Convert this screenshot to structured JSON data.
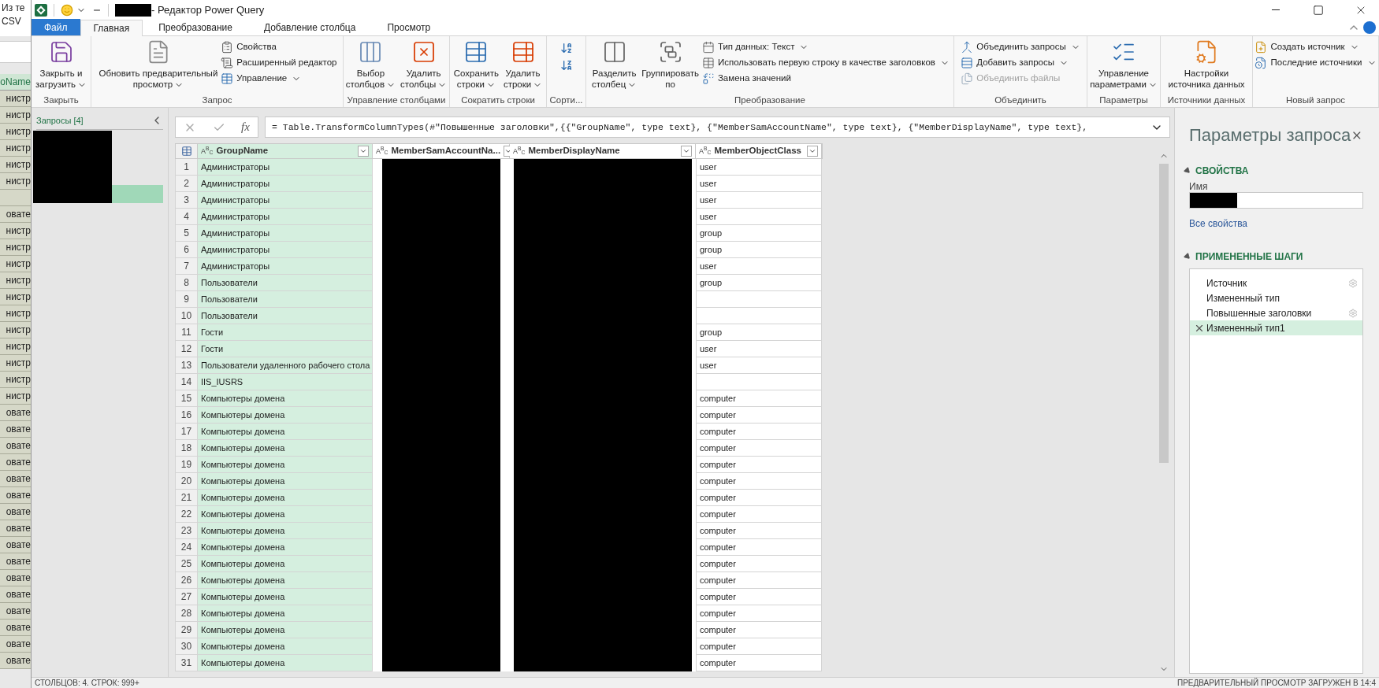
{
  "background_window": {
    "header_lines": [
      "Из те",
      "CSV"
    ],
    "column_header": "oName",
    "rows": [
      "нистр",
      "нистр",
      "нистр",
      "нистр",
      "нистр",
      "нистр",
      "",
      "овате",
      "нистр",
      "нистр",
      "нистр",
      "нистр",
      "нистр",
      "нистр",
      "нистр",
      "нистр",
      "нистр",
      "нистр",
      "нистр",
      "овате",
      "овате",
      "овате",
      "овате",
      "овате",
      "овате",
      "овате",
      "овате",
      "овате",
      "овате",
      "овате",
      "овате",
      "овате",
      "овате",
      "овате",
      "овате"
    ]
  },
  "window": {
    "title": "- Редактор Power Query"
  },
  "tabs": [
    {
      "label": "Файл",
      "kind": "file",
      "selected": false
    },
    {
      "label": "Главная",
      "kind": "tab",
      "selected": true
    },
    {
      "label": "Преобразование",
      "kind": "tab",
      "selected": false
    },
    {
      "label": "Добавление столбца",
      "kind": "tab",
      "selected": false
    },
    {
      "label": "Просмотр",
      "kind": "tab",
      "selected": false
    }
  ],
  "ribbon": [
    {
      "label": "Закрыть",
      "items": [
        {
          "kind": "large",
          "lines": [
            "Закрыть и",
            "загрузить"
          ],
          "dropdown": true,
          "disabled": false
        }
      ]
    },
    {
      "label": "Запрос",
      "items": [
        {
          "kind": "large",
          "lines": [
            "Обновить предварительный",
            "просмотр"
          ],
          "dropdown": true,
          "disabled": false
        },
        {
          "kind": "small",
          "lines": [
            "Свойства"
          ],
          "dropdown": false,
          "disabled": false
        },
        {
          "kind": "small",
          "lines": [
            "Расширенный редактор"
          ],
          "dropdown": false,
          "disabled": false
        },
        {
          "kind": "small",
          "lines": [
            "Управление"
          ],
          "dropdown": true,
          "disabled": false
        }
      ]
    },
    {
      "label": "Управление столбцами",
      "items": [
        {
          "kind": "large",
          "lines": [
            "Выбор",
            "столбцов"
          ],
          "dropdown": true,
          "disabled": false
        },
        {
          "kind": "large",
          "lines": [
            "Удалить",
            "столбцы"
          ],
          "dropdown": true,
          "disabled": false
        }
      ]
    },
    {
      "label": "Сократить строки",
      "items": [
        {
          "kind": "large",
          "lines": [
            "Сохранить",
            "строки"
          ],
          "dropdown": true,
          "disabled": false
        },
        {
          "kind": "large",
          "lines": [
            "Удалить",
            "строки"
          ],
          "dropdown": true,
          "disabled": false
        }
      ]
    },
    {
      "label": "Сорти...",
      "items": [
        {
          "kind": "icon",
          "disabled": false
        },
        {
          "kind": "icon",
          "disabled": false
        }
      ]
    },
    {
      "label": "Преобразование",
      "items": [
        {
          "kind": "large",
          "lines": [
            "Разделить",
            "столбец"
          ],
          "dropdown": true,
          "disabled": false
        },
        {
          "kind": "large",
          "lines": [
            "Группировать",
            "по"
          ],
          "dropdown": false,
          "disabled": false
        },
        {
          "kind": "small",
          "lines": [
            "Тип данных: Текст"
          ],
          "dropdown": true,
          "disabled": false
        },
        {
          "kind": "small",
          "lines": [
            "Использовать первую строку в качестве заголовков"
          ],
          "dropdown": true,
          "disabled": false
        },
        {
          "kind": "small",
          "lines": [
            "Замена значений"
          ],
          "dropdown": false,
          "disabled": false
        }
      ]
    },
    {
      "label": "Объединить",
      "items": [
        {
          "kind": "small",
          "lines": [
            "Объединить запросы"
          ],
          "dropdown": true,
          "disabled": false
        },
        {
          "kind": "small",
          "lines": [
            "Добавить запросы"
          ],
          "dropdown": true,
          "disabled": false
        },
        {
          "kind": "small",
          "lines": [
            "Объединить файлы"
          ],
          "dropdown": false,
          "disabled": true
        }
      ]
    },
    {
      "label": "Параметры",
      "items": [
        {
          "kind": "large",
          "lines": [
            "Управление",
            "параметрами"
          ],
          "dropdown": true,
          "disabled": false
        }
      ]
    },
    {
      "label": "Источники данных",
      "items": [
        {
          "kind": "large",
          "lines": [
            "Настройки",
            "источника данных"
          ],
          "dropdown": false,
          "disabled": false
        }
      ]
    },
    {
      "label": "Новый запрос",
      "items": [
        {
          "kind": "small",
          "lines": [
            "Создать источник"
          ],
          "dropdown": true,
          "disabled": false
        },
        {
          "kind": "small",
          "lines": [
            "Последние источники"
          ],
          "dropdown": true,
          "disabled": false
        }
      ]
    }
  ],
  "queries_pane": {
    "title": "Запросы [4]",
    "items": [
      {
        "selected": false
      },
      {
        "selected": false
      },
      {
        "selected": false
      },
      {
        "selected": true
      }
    ]
  },
  "formula_bar": {
    "fx_label": "fx",
    "formula": "= Table.TransformColumnTypes(#\"Повышенные заголовки\",{{\"GroupName\", type text}, {\"MemberSamAccountName\", type text}, {\"MemberDisplayName\", type text},"
  },
  "table": {
    "columns": [
      {
        "type_badge": "A$^{B}$$_{C}$",
        "name": "GroupName",
        "selected": true
      },
      {
        "type_badge": "A$^{B}$$_{C}$",
        "name": "MemberSamAccountNa...",
        "selected": false
      },
      {
        "type_badge": "A$^{B}$$_{C}$",
        "name": "MemberDisplayName",
        "selected": false
      },
      {
        "type_badge": "A$^{B}$$_{C}$",
        "name": "MemberObjectClass",
        "selected": false
      }
    ],
    "rows": [
      {
        "n": "1",
        "group": "Администраторы",
        "class": "user"
      },
      {
        "n": "2",
        "group": "Администраторы",
        "class": "user"
      },
      {
        "n": "3",
        "group": "Администраторы",
        "class": "user"
      },
      {
        "n": "4",
        "group": "Администраторы",
        "class": "user"
      },
      {
        "n": "5",
        "group": "Администраторы",
        "class": "group"
      },
      {
        "n": "6",
        "group": "Администраторы",
        "class": "group"
      },
      {
        "n": "7",
        "group": "Администраторы",
        "class": "user"
      },
      {
        "n": "8",
        "group": "Пользователи",
        "class": "group"
      },
      {
        "n": "9",
        "group": "Пользователи"
      },
      {
        "n": "10",
        "group": "Пользователи"
      },
      {
        "n": "11",
        "group": "Гости",
        "class": "group"
      },
      {
        "n": "12",
        "group": "Гости",
        "class": "user"
      },
      {
        "n": "13",
        "group": "Пользователи удаленного рабочего стола",
        "class": "user"
      },
      {
        "n": "14",
        "group": "IIS_IUSRS"
      },
      {
        "n": "15",
        "group": "Компьютеры домена",
        "class": "computer"
      },
      {
        "n": "16",
        "group": "Компьютеры домена",
        "class": "computer"
      },
      {
        "n": "17",
        "group": "Компьютеры домена",
        "class": "computer"
      },
      {
        "n": "18",
        "group": "Компьютеры домена",
        "class": "computer"
      },
      {
        "n": "19",
        "group": "Компьютеры домена",
        "class": "computer"
      },
      {
        "n": "20",
        "group": "Компьютеры домена",
        "class": "computer"
      },
      {
        "n": "21",
        "group": "Компьютеры домена",
        "class": "computer"
      },
      {
        "n": "22",
        "group": "Компьютеры домена",
        "class": "computer"
      },
      {
        "n": "23",
        "group": "Компьютеры домена",
        "class": "computer"
      },
      {
        "n": "24",
        "group": "Компьютеры домена",
        "class": "computer"
      },
      {
        "n": "25",
        "group": "Компьютеры домена",
        "class": "computer"
      },
      {
        "n": "26",
        "group": "Компьютеры домена",
        "class": "computer"
      },
      {
        "n": "27",
        "group": "Компьютеры домена",
        "class": "computer"
      },
      {
        "n": "28",
        "group": "Компьютеры домена",
        "class": "computer"
      },
      {
        "n": "29",
        "group": "Компьютеры домена",
        "class": "computer"
      },
      {
        "n": "30",
        "group": "Компьютеры домена",
        "class": "computer"
      },
      {
        "n": "31",
        "group": "Компьютеры домена",
        "class": "computer"
      }
    ]
  },
  "query_settings": {
    "title": "Параметры запроса",
    "properties_heading": "СВОЙСТВА",
    "name_label": "Имя",
    "all_properties_link": "Все свойства",
    "steps_heading": "ПРИМЕНЕННЫЕ ШАГИ",
    "steps": [
      {
        "label": "Источник",
        "has_settings": true,
        "selected": false
      },
      {
        "label": "Измененный тип",
        "has_settings": false,
        "selected": false
      },
      {
        "label": "Повышенные заголовки",
        "has_settings": true,
        "selected": false
      },
      {
        "label": "Измененный тип1",
        "has_settings": false,
        "selected": true
      }
    ]
  },
  "status_bar": {
    "left": "СТОЛБЦОВ: 4. СТРОК: 999+",
    "right": "ПРЕДВАРИТЕЛЬНЫЙ ПРОСМОТР ЗАГРУЖЕН В 14:4"
  }
}
